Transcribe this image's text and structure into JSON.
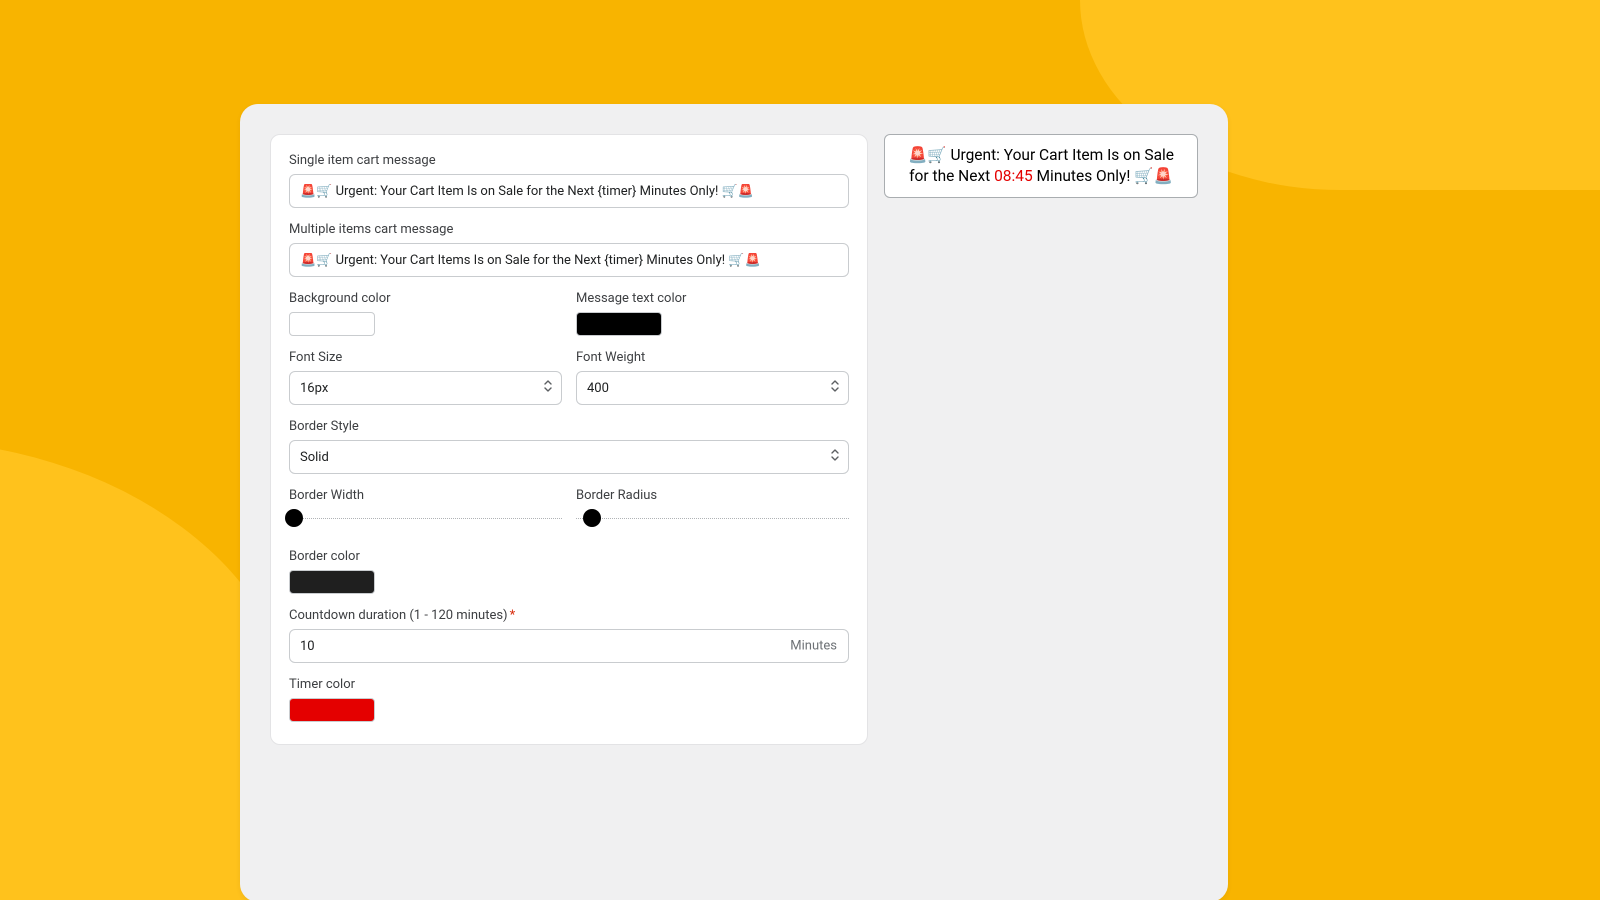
{
  "form": {
    "single_label": "Single item cart message",
    "single_value": "🚨🛒 Urgent: Your Cart Item Is on Sale for the Next {timer} Minutes Only! 🛒🚨",
    "multi_label": "Multiple items cart message",
    "multi_value": "🚨🛒 Urgent: Your Cart Items Is on Sale for the Next {timer} Minutes Only! 🛒🚨",
    "bg_color_label": "Background color",
    "bg_color_value": "#ffffff",
    "text_color_label": "Message text color",
    "text_color_value": "#000000",
    "font_size_label": "Font Size",
    "font_size_value": "16px",
    "font_weight_label": "Font Weight",
    "font_weight_value": "400",
    "border_style_label": "Border Style",
    "border_style_value": "Solid",
    "border_width_label": "Border Width",
    "border_width_pct": 2,
    "border_radius_label": "Border Radius",
    "border_radius_pct": 6,
    "border_color_label": "Border color",
    "border_color_value": "#1f1f1f",
    "countdown_label": "Countdown duration (1 - 120 minutes)",
    "countdown_value": "10",
    "countdown_suffix": "Minutes",
    "timer_color_label": "Timer color",
    "timer_color_value": "#e40000"
  },
  "preview": {
    "prefix": "🚨🛒 Urgent: Your Cart Item Is on Sale for the Next ",
    "timer": "08:45",
    "suffix": " Minutes Only! 🛒🚨"
  }
}
